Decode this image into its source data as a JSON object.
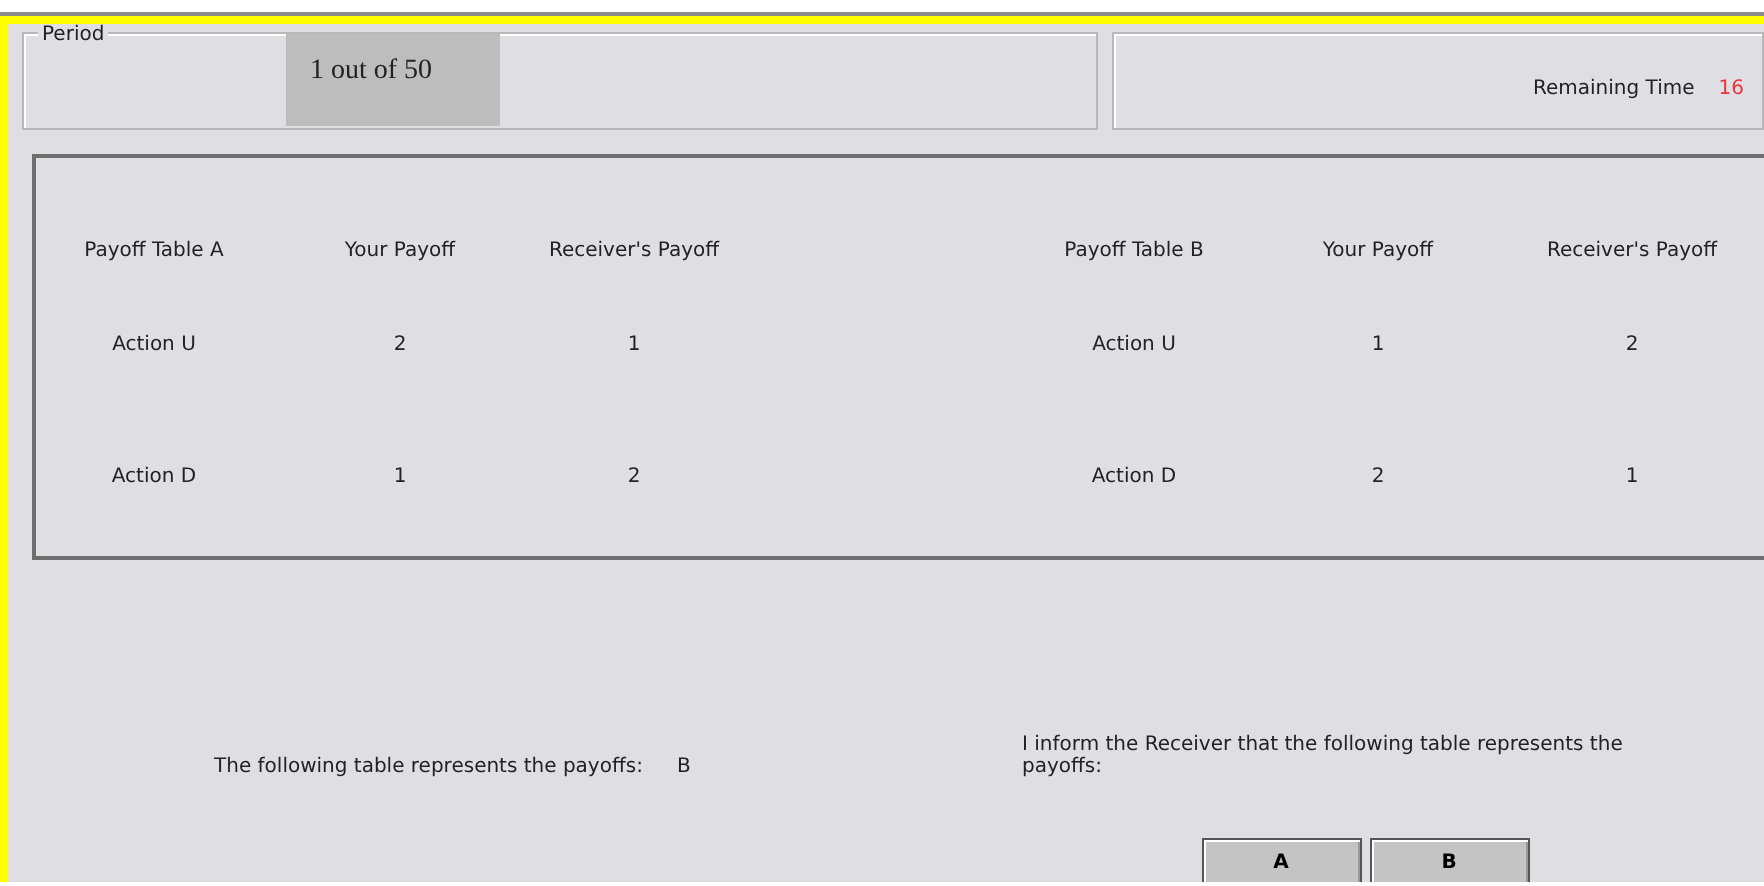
{
  "period": {
    "label": "Period",
    "value": "1 out of 50"
  },
  "timer": {
    "label": "Remaining Time",
    "value": "16"
  },
  "tables": [
    {
      "columns": [
        "Payoff Table A",
        "Your Payoff",
        "Receiver's Payoff"
      ],
      "rows": [
        [
          "Action U",
          "2",
          "1"
        ],
        [
          "Action D",
          "1",
          "2"
        ]
      ]
    },
    {
      "columns": [
        "Payoff Table B",
        "Your Payoff",
        "Receiver's Payoff"
      ],
      "rows": [
        [
          "Action U",
          "1",
          "2"
        ],
        [
          "Action D",
          "2",
          "1"
        ]
      ]
    }
  ],
  "truth": {
    "label": "The following table represents the payoffs:",
    "value": "B"
  },
  "inform": {
    "prompt": "I inform the Receiver that the following table represents the payoffs:",
    "buttons": [
      "A",
      "B"
    ]
  }
}
